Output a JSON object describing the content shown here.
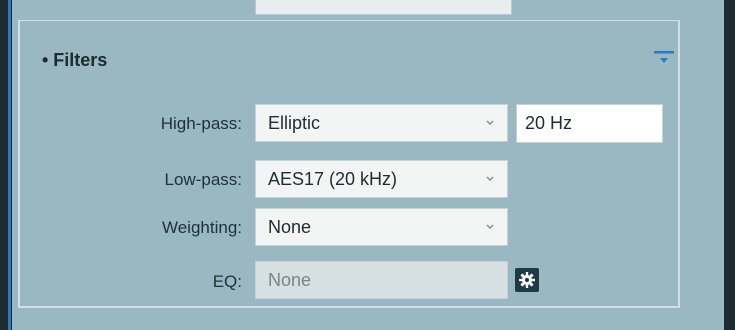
{
  "section": {
    "title": "• Filters"
  },
  "icons": {
    "collapse": "collapse-icon",
    "chevron": "chevron-down-icon",
    "settings": "gear-icon"
  },
  "filters": {
    "high_pass": {
      "label": "High-pass:",
      "value": "Elliptic",
      "frequency": "20 Hz"
    },
    "low_pass": {
      "label": "Low-pass:",
      "value": "AES17 (20 kHz)"
    },
    "weighting": {
      "label": "Weighting:",
      "value": "None"
    },
    "eq": {
      "label": "EQ:",
      "value": "None"
    }
  },
  "colors": {
    "panel": "#9ab8c1",
    "accent": "#2b78c7",
    "gear_bg": "#1f3a47"
  }
}
